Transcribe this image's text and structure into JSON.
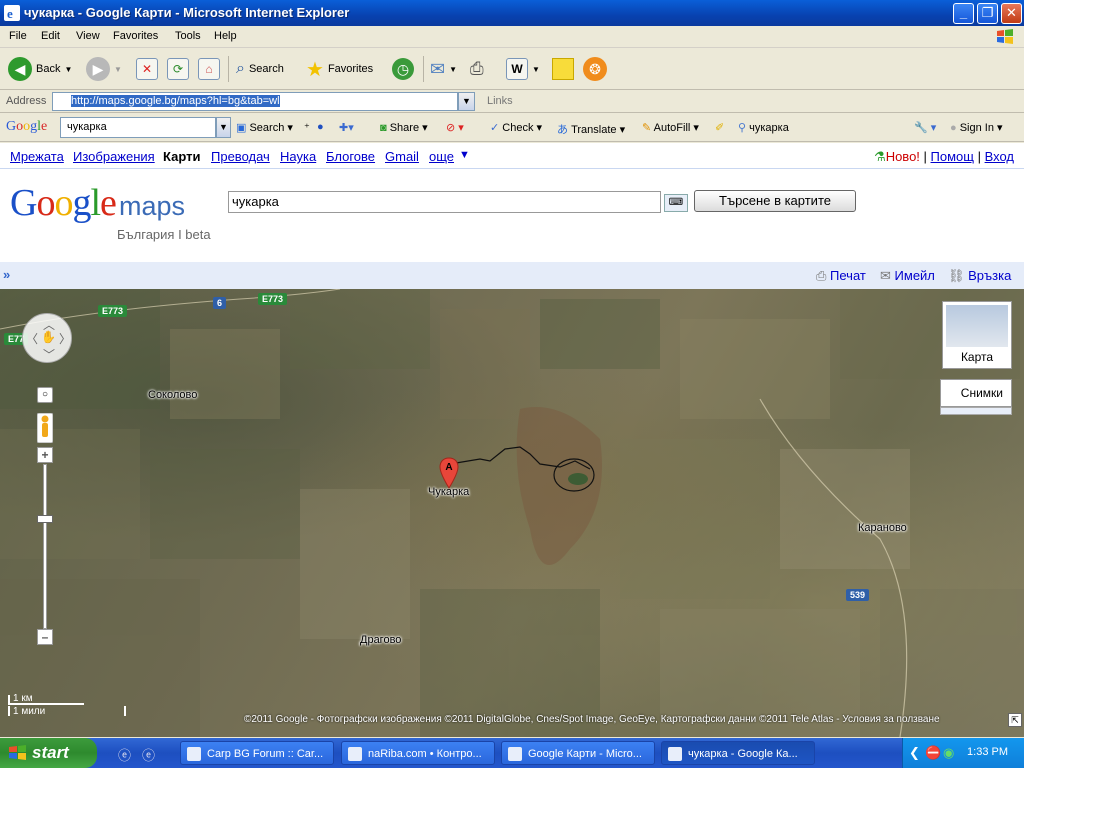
{
  "window": {
    "title": "чукарка - Google Карти - Microsoft Internet Explorer",
    "menu": [
      "File",
      "Edit",
      "View",
      "Favorites",
      "Tools",
      "Help"
    ],
    "toolbar": {
      "back": "Back",
      "search": "Search",
      "favorites": "Favorites"
    },
    "address_label": "Address",
    "address_url": "http://maps.google.bg/maps?hl=bg&tab=wl",
    "links_label": "Links"
  },
  "google_toolbar": {
    "logo": "Google",
    "query": "чукарка",
    "search": "Search",
    "share": "Share",
    "check": "Check",
    "translate": "Translate",
    "autofill": "AutoFill",
    "highlight_term": "чукарка",
    "signin": "Sign In"
  },
  "topnav": {
    "links": [
      "Мрежата",
      "Изображения",
      "Карти",
      "Преводач",
      "Наука",
      "Блогове",
      "Gmail",
      "още"
    ],
    "active": "Карти",
    "new_label": "Ново!",
    "help": "Помощ",
    "login": "Вход"
  },
  "maps": {
    "logo_google": "Google",
    "logo_maps": "maps",
    "subtitle": "България I beta",
    "query": "чукарка",
    "search_button": "Търсене в картите",
    "actions": {
      "print": "Печат",
      "email": "Имейл",
      "link": "Връзка"
    }
  },
  "map": {
    "places": [
      "Соколово",
      "Чукарка",
      "Караново",
      "Драгово"
    ],
    "roads": [
      "E773",
      "6",
      "E773",
      "E77",
      "539"
    ],
    "marker": "A",
    "type_map": "Карта",
    "type_satellite": "Снимки",
    "scale_km": "1 км",
    "scale_mi": "1 мили",
    "copyright": "©2011 Google - Фотографски изображения ©2011 DigitalGlobe, Cnes/Spot Image, GeoEye, Картографски данни ©2011 Tele Atlas - Условия за ползване"
  },
  "taskbar": {
    "start": "start",
    "tasks": [
      "Carp BG Forum :: Car...",
      "naRiba.com • Контро...",
      "Google Карти - Micro...",
      "чукарка - Google Ка..."
    ],
    "clock": "1:33 PM"
  }
}
